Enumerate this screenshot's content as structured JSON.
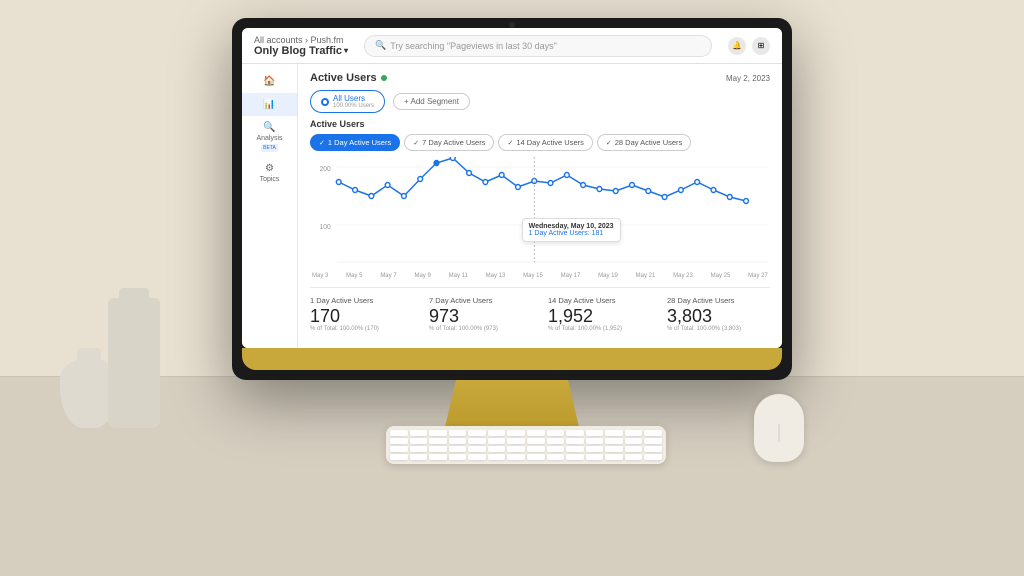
{
  "scene": {
    "background_color": "#e8e0d0",
    "desk_color": "#d6cfc0"
  },
  "monitor": {
    "bezel_color": "#1a1a1a",
    "chin_color": "#c8a83a",
    "stand_color": "#c8a83a",
    "base_color": "#b09030"
  },
  "ga": {
    "breadcrumb": "All accounts › Push.fm",
    "title": "Only Blog Traffic",
    "search_placeholder": "Try searching \"Pageviews in last 30 days\"",
    "date": "May 2, 2023",
    "header_icons": [
      "bell",
      "grid"
    ],
    "page_title": "Active Users",
    "green_dot": true,
    "segment_label": "All Users",
    "segment_sub": "100.00% Users",
    "add_segment": "+ Add Segment",
    "active_users_section": "Active Users",
    "tabs": [
      {
        "label": "1 Day Active Users",
        "active": true
      },
      {
        "label": "7 Day Active Users",
        "active": false
      },
      {
        "label": "14 Day Active Users",
        "active": false
      },
      {
        "label": "28 Day Active Users",
        "active": false
      }
    ],
    "chart_y_max": 200,
    "chart_y_mid": 100,
    "chart_data": [
      168,
      155,
      145,
      162,
      145,
      172,
      195,
      205,
      178,
      165,
      175,
      160,
      170,
      165,
      175,
      162,
      158,
      155,
      162,
      155,
      148,
      158,
      168,
      158,
      148,
      142
    ],
    "tooltip": {
      "date": "Wednesday, May 10, 2023",
      "label": "1 Day Active Users: 181"
    },
    "x_labels": [
      "May 3",
      "May 5",
      "May 7",
      "May 9",
      "May 11",
      "May 13",
      "May 15",
      "May 17",
      "May 19",
      "May 21",
      "May 23",
      "May 25",
      "May 27"
    ],
    "metrics": [
      {
        "label": "1 Day Active Users",
        "value": "170",
        "sub": "% of Total: 100.00% (170)"
      },
      {
        "label": "7 Day Active Users",
        "value": "973",
        "sub": "% of Total: 100.00% (973)"
      },
      {
        "label": "14 Day Active Users",
        "value": "1,952",
        "sub": "% of Total: 100.00% (1,952)"
      },
      {
        "label": "28 Day Active Users",
        "value": "3,803",
        "sub": "% of Total: 100.00% (3,803)"
      }
    ],
    "nav_items": [
      {
        "icon": "🏠",
        "label": ""
      },
      {
        "icon": "📊",
        "label": ""
      },
      {
        "icon": "🔍",
        "label": "Analysis",
        "beta": true
      },
      {
        "icon": "📈",
        "label": ""
      },
      {
        "icon": "⚙",
        "label": "Topics"
      }
    ]
  }
}
